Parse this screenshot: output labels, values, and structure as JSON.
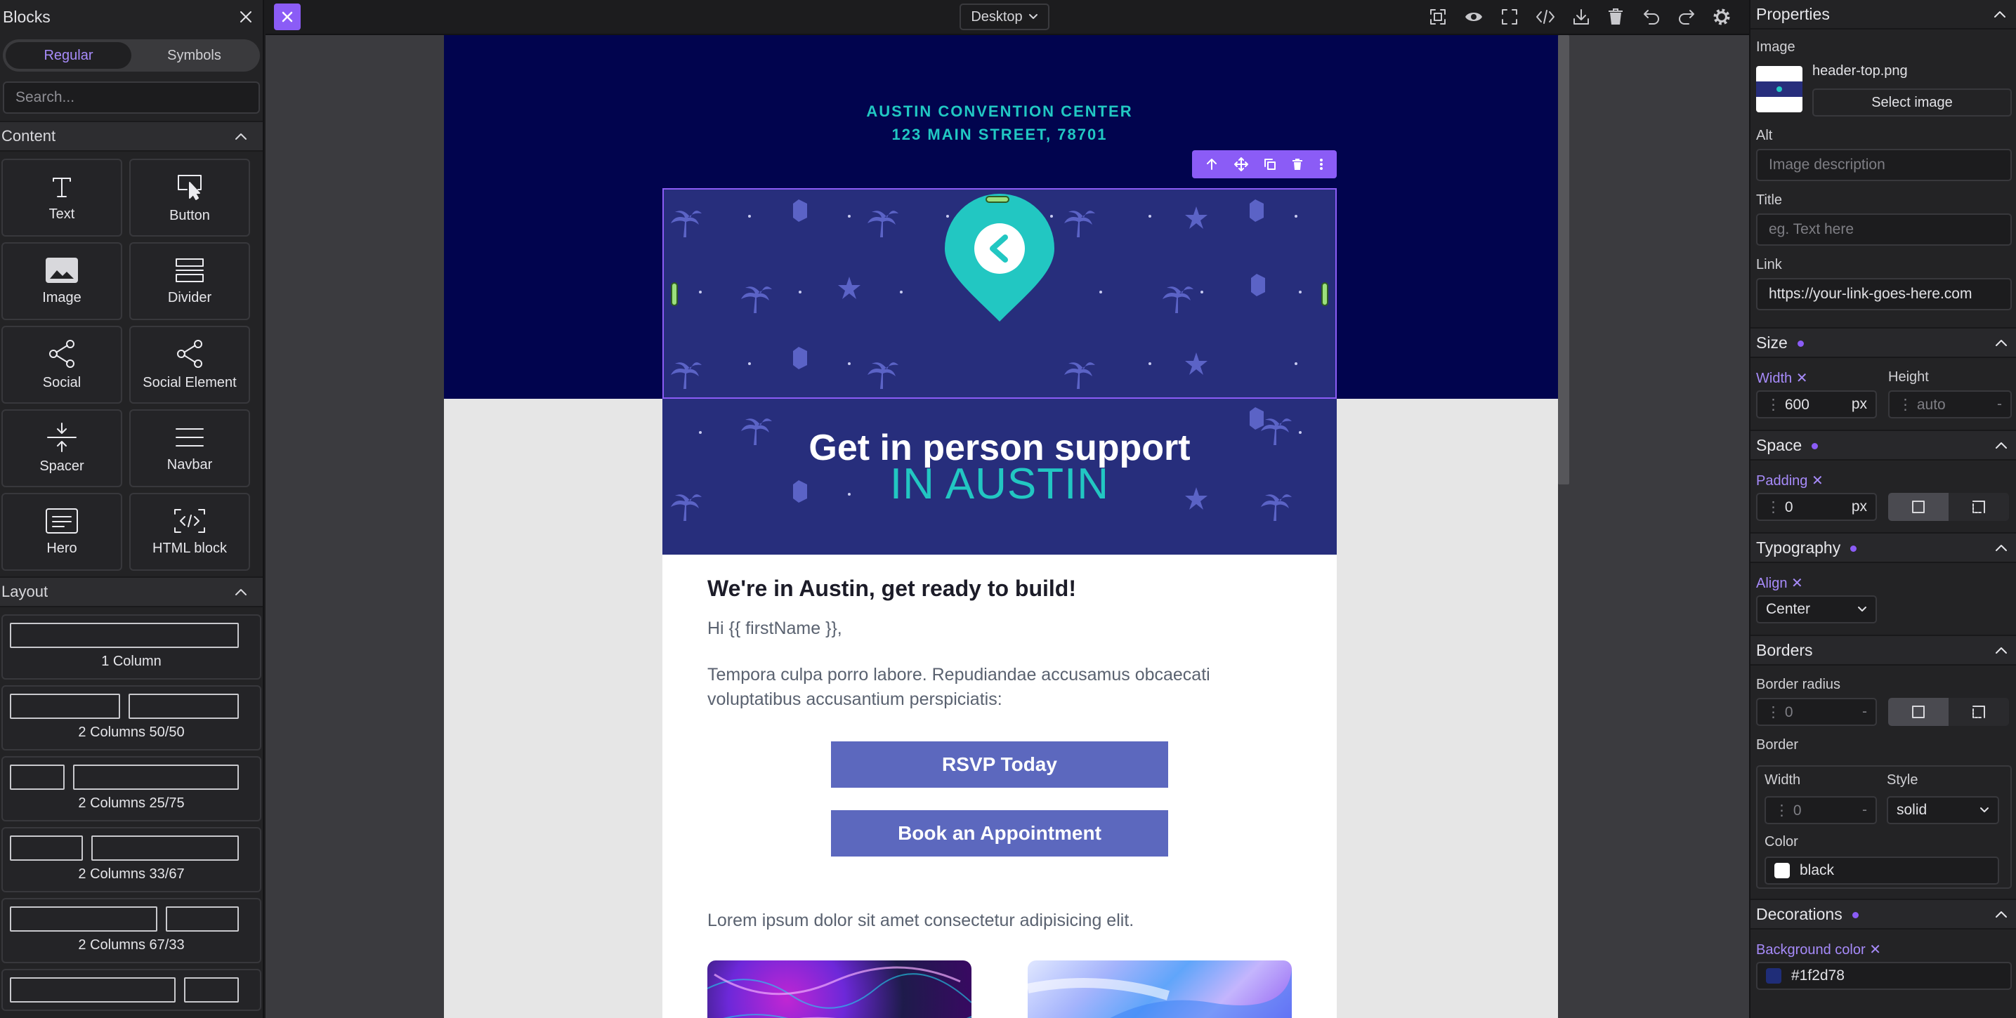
{
  "left_panel": {
    "title": "Blocks",
    "tabs": [
      "Regular",
      "Symbols"
    ],
    "search_placeholder": "Search...",
    "content_section": "Content",
    "blocks": [
      "Text",
      "Button",
      "Image",
      "Divider",
      "Social",
      "Social Element",
      "Spacer",
      "Navbar",
      "Hero",
      "HTML block"
    ],
    "layout_section": "Layout",
    "layouts": [
      "1 Column",
      "2 Columns 50/50",
      "2 Columns 25/75",
      "2 Columns 33/67",
      "2 Columns 67/33"
    ]
  },
  "topbar": {
    "device": "Desktop"
  },
  "email": {
    "address_line1": "AUSTIN CONVENTION CENTER",
    "address_line2": "123 MAIN STREET, 78701",
    "hero_title": "Get in person support",
    "hero_subtitle": "IN AUSTIN",
    "heading": "We're in Austin, get ready to build!",
    "greeting": "Hi {{ firstName }},",
    "paragraph": "Tempora culpa porro labore. Repudiandae accusamus obcaecati voluptatibus accusantium perspiciatis:",
    "button1": "RSVP Today",
    "button2": "Book an Appointment",
    "lorem": "Lorem ipsum dolor sit amet consectetur adipisicing elit."
  },
  "properties": {
    "title": "Properties",
    "image_label": "Image",
    "image_filename": "header-top.png",
    "select_image": "Select image",
    "alt_label": "Alt",
    "alt_placeholder": "Image description",
    "title_label": "Title",
    "title_placeholder": "eg. Text here",
    "link_label": "Link",
    "link_value": "https://your-link-goes-here.com",
    "size_section": "Size",
    "width_label": "Width",
    "width_value": "600",
    "width_unit": "px",
    "height_label": "Height",
    "height_value": "auto",
    "height_unit": "-",
    "space_section": "Space",
    "padding_label": "Padding",
    "padding_value": "0",
    "padding_unit": "px",
    "typography_section": "Typography",
    "align_label": "Align",
    "align_value": "Center",
    "borders_section": "Borders",
    "radius_label": "Border radius",
    "radius_value": "0",
    "radius_unit": "-",
    "border_label": "Border",
    "border_width_label": "Width",
    "border_width_value": "0",
    "border_width_unit": "-",
    "border_style_label": "Style",
    "border_style_value": "solid",
    "color_label": "Color",
    "color_value": "black",
    "decorations_section": "Decorations",
    "bg_label": "Background color",
    "bg_value": "#1f2d78"
  },
  "colors": {
    "accent": "#8b5cf6",
    "email_header": "#01044e",
    "banner": "#272e7c",
    "teal": "#22c7c2",
    "button": "#5c68be"
  }
}
